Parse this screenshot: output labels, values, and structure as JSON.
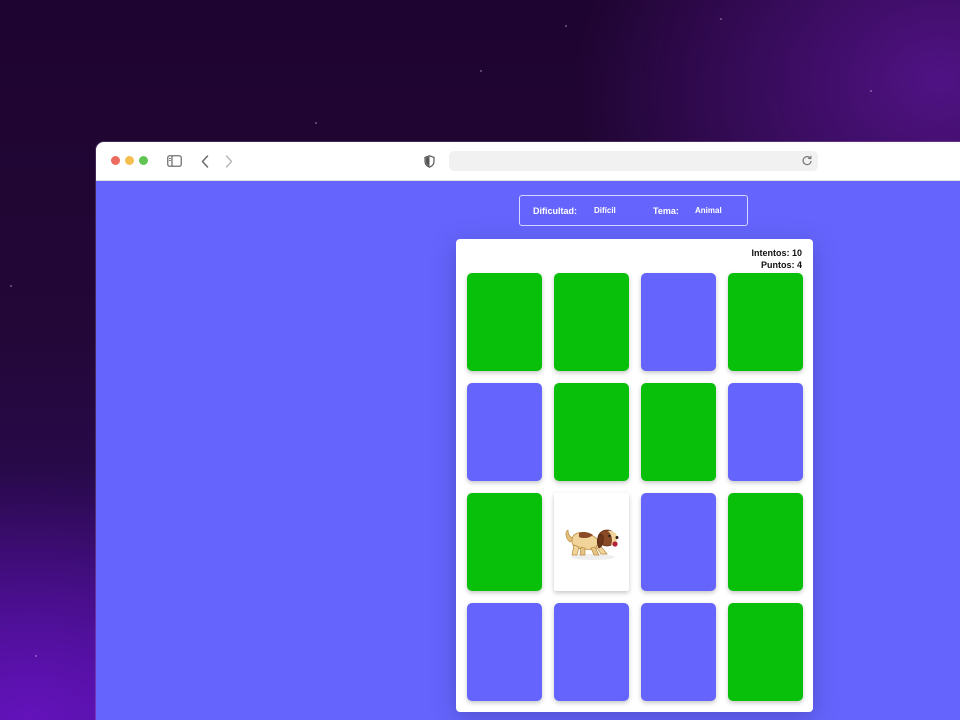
{
  "settings": {
    "difficulty_label": "Dificultad:",
    "difficulty_value": "Difícil",
    "theme_label": "Tema:",
    "theme_value": "Animal"
  },
  "score": {
    "attempts": "Intentos: 10",
    "points": "Puntos: 4"
  },
  "colors": {
    "matched": "#08c00a",
    "hidden": "#6565fd",
    "page_background": "#6565fd"
  },
  "cards": [
    {
      "state": "matched"
    },
    {
      "state": "matched"
    },
    {
      "state": "hidden"
    },
    {
      "state": "matched"
    },
    {
      "state": "hidden"
    },
    {
      "state": "matched"
    },
    {
      "state": "matched"
    },
    {
      "state": "hidden"
    },
    {
      "state": "matched"
    },
    {
      "state": "revealed",
      "icon": "dog-icon"
    },
    {
      "state": "hidden"
    },
    {
      "state": "matched"
    },
    {
      "state": "hidden"
    },
    {
      "state": "hidden"
    },
    {
      "state": "hidden"
    },
    {
      "state": "matched"
    }
  ]
}
